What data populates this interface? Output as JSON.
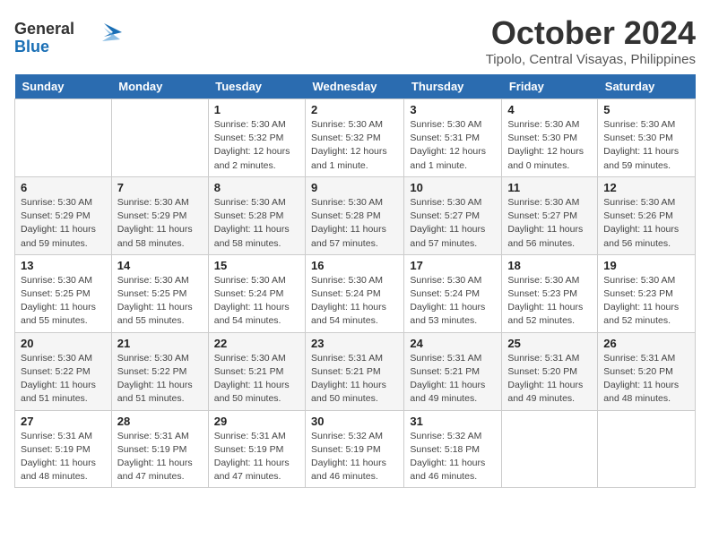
{
  "header": {
    "logo_general": "General",
    "logo_blue": "Blue",
    "month": "October 2024",
    "location": "Tipolo, Central Visayas, Philippines"
  },
  "days_of_week": [
    "Sunday",
    "Monday",
    "Tuesday",
    "Wednesday",
    "Thursday",
    "Friday",
    "Saturday"
  ],
  "weeks": [
    [
      {
        "day": "",
        "info": ""
      },
      {
        "day": "",
        "info": ""
      },
      {
        "day": "1",
        "info": "Sunrise: 5:30 AM\nSunset: 5:32 PM\nDaylight: 12 hours\nand 2 minutes."
      },
      {
        "day": "2",
        "info": "Sunrise: 5:30 AM\nSunset: 5:32 PM\nDaylight: 12 hours\nand 1 minute."
      },
      {
        "day": "3",
        "info": "Sunrise: 5:30 AM\nSunset: 5:31 PM\nDaylight: 12 hours\nand 1 minute."
      },
      {
        "day": "4",
        "info": "Sunrise: 5:30 AM\nSunset: 5:30 PM\nDaylight: 12 hours\nand 0 minutes."
      },
      {
        "day": "5",
        "info": "Sunrise: 5:30 AM\nSunset: 5:30 PM\nDaylight: 11 hours\nand 59 minutes."
      }
    ],
    [
      {
        "day": "6",
        "info": "Sunrise: 5:30 AM\nSunset: 5:29 PM\nDaylight: 11 hours\nand 59 minutes."
      },
      {
        "day": "7",
        "info": "Sunrise: 5:30 AM\nSunset: 5:29 PM\nDaylight: 11 hours\nand 58 minutes."
      },
      {
        "day": "8",
        "info": "Sunrise: 5:30 AM\nSunset: 5:28 PM\nDaylight: 11 hours\nand 58 minutes."
      },
      {
        "day": "9",
        "info": "Sunrise: 5:30 AM\nSunset: 5:28 PM\nDaylight: 11 hours\nand 57 minutes."
      },
      {
        "day": "10",
        "info": "Sunrise: 5:30 AM\nSunset: 5:27 PM\nDaylight: 11 hours\nand 57 minutes."
      },
      {
        "day": "11",
        "info": "Sunrise: 5:30 AM\nSunset: 5:27 PM\nDaylight: 11 hours\nand 56 minutes."
      },
      {
        "day": "12",
        "info": "Sunrise: 5:30 AM\nSunset: 5:26 PM\nDaylight: 11 hours\nand 56 minutes."
      }
    ],
    [
      {
        "day": "13",
        "info": "Sunrise: 5:30 AM\nSunset: 5:25 PM\nDaylight: 11 hours\nand 55 minutes."
      },
      {
        "day": "14",
        "info": "Sunrise: 5:30 AM\nSunset: 5:25 PM\nDaylight: 11 hours\nand 55 minutes."
      },
      {
        "day": "15",
        "info": "Sunrise: 5:30 AM\nSunset: 5:24 PM\nDaylight: 11 hours\nand 54 minutes."
      },
      {
        "day": "16",
        "info": "Sunrise: 5:30 AM\nSunset: 5:24 PM\nDaylight: 11 hours\nand 54 minutes."
      },
      {
        "day": "17",
        "info": "Sunrise: 5:30 AM\nSunset: 5:24 PM\nDaylight: 11 hours\nand 53 minutes."
      },
      {
        "day": "18",
        "info": "Sunrise: 5:30 AM\nSunset: 5:23 PM\nDaylight: 11 hours\nand 52 minutes."
      },
      {
        "day": "19",
        "info": "Sunrise: 5:30 AM\nSunset: 5:23 PM\nDaylight: 11 hours\nand 52 minutes."
      }
    ],
    [
      {
        "day": "20",
        "info": "Sunrise: 5:30 AM\nSunset: 5:22 PM\nDaylight: 11 hours\nand 51 minutes."
      },
      {
        "day": "21",
        "info": "Sunrise: 5:30 AM\nSunset: 5:22 PM\nDaylight: 11 hours\nand 51 minutes."
      },
      {
        "day": "22",
        "info": "Sunrise: 5:30 AM\nSunset: 5:21 PM\nDaylight: 11 hours\nand 50 minutes."
      },
      {
        "day": "23",
        "info": "Sunrise: 5:31 AM\nSunset: 5:21 PM\nDaylight: 11 hours\nand 50 minutes."
      },
      {
        "day": "24",
        "info": "Sunrise: 5:31 AM\nSunset: 5:21 PM\nDaylight: 11 hours\nand 49 minutes."
      },
      {
        "day": "25",
        "info": "Sunrise: 5:31 AM\nSunset: 5:20 PM\nDaylight: 11 hours\nand 49 minutes."
      },
      {
        "day": "26",
        "info": "Sunrise: 5:31 AM\nSunset: 5:20 PM\nDaylight: 11 hours\nand 48 minutes."
      }
    ],
    [
      {
        "day": "27",
        "info": "Sunrise: 5:31 AM\nSunset: 5:19 PM\nDaylight: 11 hours\nand 48 minutes."
      },
      {
        "day": "28",
        "info": "Sunrise: 5:31 AM\nSunset: 5:19 PM\nDaylight: 11 hours\nand 47 minutes."
      },
      {
        "day": "29",
        "info": "Sunrise: 5:31 AM\nSunset: 5:19 PM\nDaylight: 11 hours\nand 47 minutes."
      },
      {
        "day": "30",
        "info": "Sunrise: 5:32 AM\nSunset: 5:19 PM\nDaylight: 11 hours\nand 46 minutes."
      },
      {
        "day": "31",
        "info": "Sunrise: 5:32 AM\nSunset: 5:18 PM\nDaylight: 11 hours\nand 46 minutes."
      },
      {
        "day": "",
        "info": ""
      },
      {
        "day": "",
        "info": ""
      }
    ]
  ]
}
